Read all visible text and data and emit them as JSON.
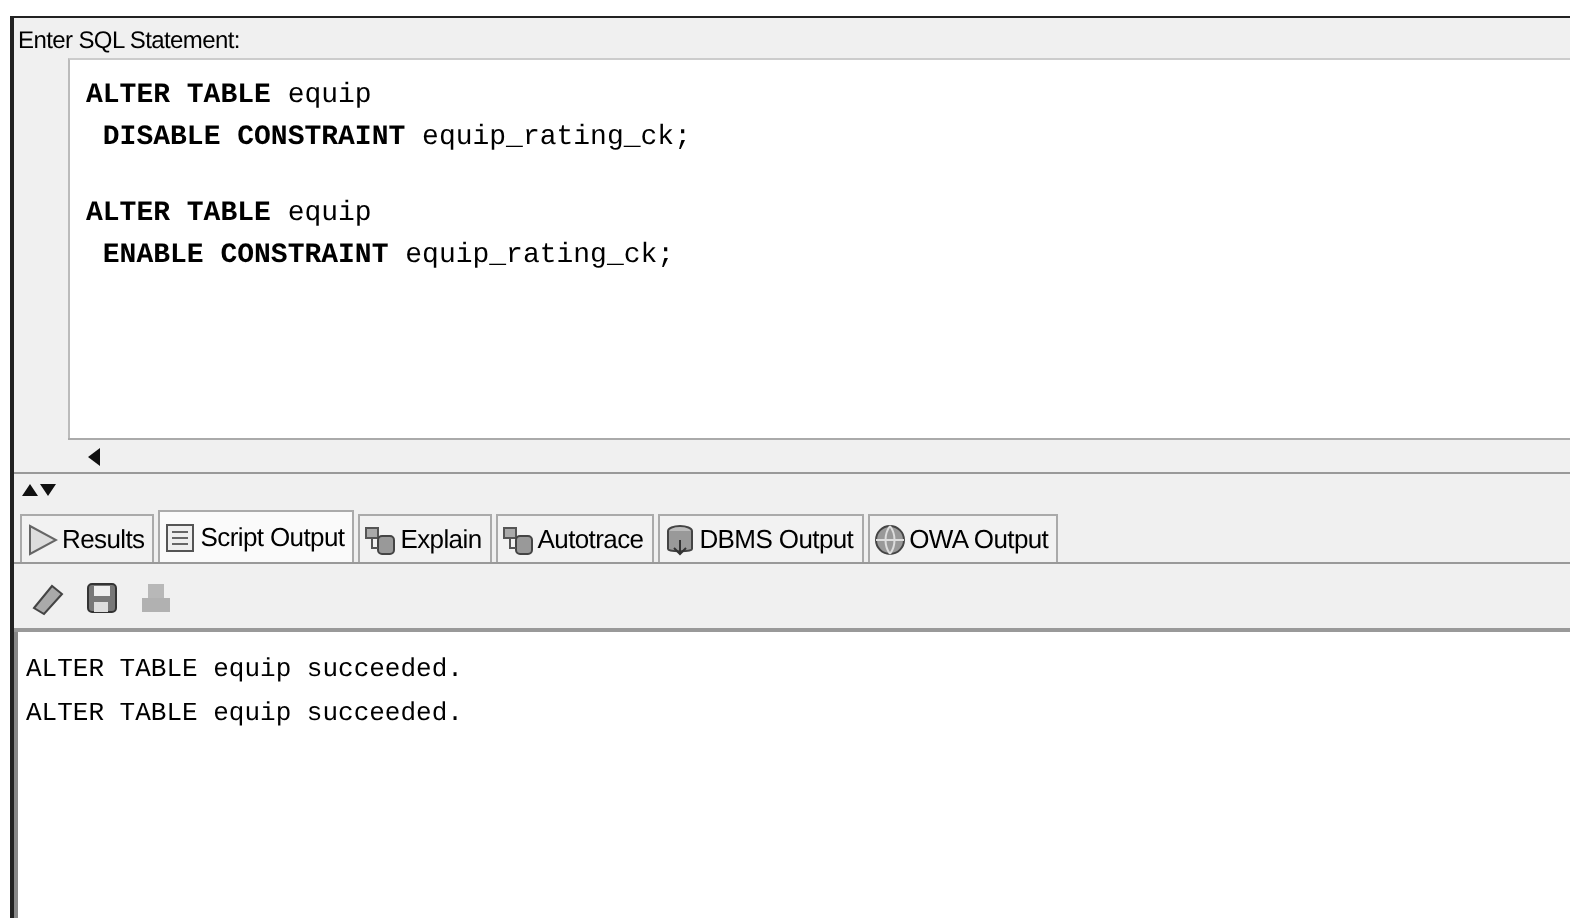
{
  "editor": {
    "label": "Enter SQL Statement:",
    "statements": [
      {
        "lines": [
          "**ALTER TABLE** equip",
          " **DISABLE CONSTRAINT** equip_rating_ck;"
        ]
      },
      {
        "lines": [
          "**ALTER TABLE** equip",
          " **ENABLE CONSTRAINT** equip_rating_ck;"
        ]
      }
    ]
  },
  "tabs": [
    {
      "label": "Results",
      "kind": "play",
      "selected": false
    },
    {
      "label": "Script Output",
      "kind": "script",
      "selected": true
    },
    {
      "label": "Explain",
      "kind": "explain",
      "selected": false
    },
    {
      "label": "Autotrace",
      "kind": "explain",
      "selected": false
    },
    {
      "label": "DBMS Output",
      "kind": "dbms",
      "selected": false
    },
    {
      "label": "OWA Output",
      "kind": "globe",
      "selected": false
    }
  ],
  "toolbar": [
    {
      "kind": "eraser",
      "disabled": false
    },
    {
      "kind": "save",
      "disabled": false
    },
    {
      "kind": "print",
      "disabled": true
    }
  ],
  "output": [
    "ALTER TABLE equip succeeded.",
    "ALTER TABLE equip succeeded."
  ]
}
